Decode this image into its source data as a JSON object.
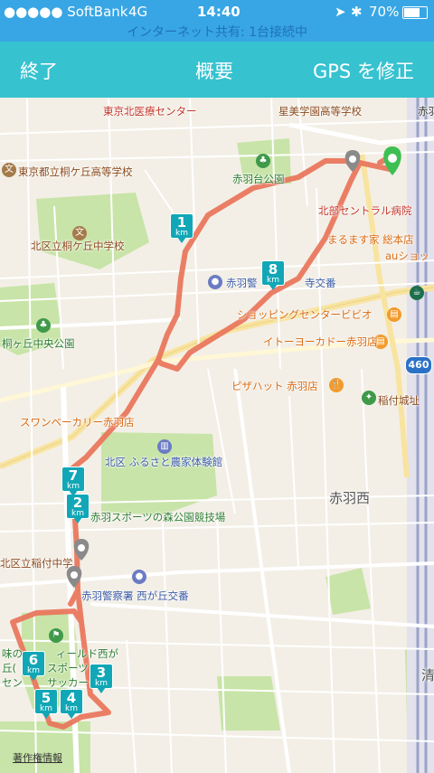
{
  "status_bar": {
    "carrier": "●●●●● SoftBank",
    "network": "4G",
    "time": "14:40",
    "battery": "70%",
    "hotspot": "インターネット共有: 1台接続中"
  },
  "nav": {
    "end_label": "終了",
    "summary_label": "概要",
    "gps_fix_label": "GPS を修正"
  },
  "map": {
    "labels": {
      "l1": "東京北医療センター",
      "l2": "星美学園高等学校",
      "l3": "赤羽",
      "l4": "東京都立桐ケ丘高等学校",
      "l5": "赤羽台公園",
      "l6": "北部セントラル病院",
      "l7": "北区立桐ケ丘中学校",
      "l8": "まるます家 総本店",
      "l9": "auショッ",
      "l10": "赤羽警",
      "l11": "寺交番",
      "l12": "ショッピングセンタービビオ",
      "l13": "桐ヶ丘中央公園",
      "l14": "イトーヨーカドー赤羽店",
      "l15": "ピザハット 赤羽店",
      "l16": "稲付城址",
      "l17": "スワンベーカリー赤羽店",
      "l18": "北区 ふるさと農家体験館",
      "l19": "赤羽西",
      "l20": "赤羽スポーツの森公園競技場",
      "l21": "北区立稲付中学",
      "l22": "赤羽警察署 西が丘交番",
      "l23": "味の",
      "l24": "ィールド西が",
      "l25": "丘(",
      "l26": "スポーツ",
      "l27": "セン",
      "l28": "サッカー",
      "l29": "清",
      "route": "460"
    },
    "km_markers": [
      "1",
      "2",
      "3",
      "4",
      "5",
      "6",
      "7",
      "8"
    ],
    "km_unit": "km",
    "copyright": "著作権情報"
  }
}
